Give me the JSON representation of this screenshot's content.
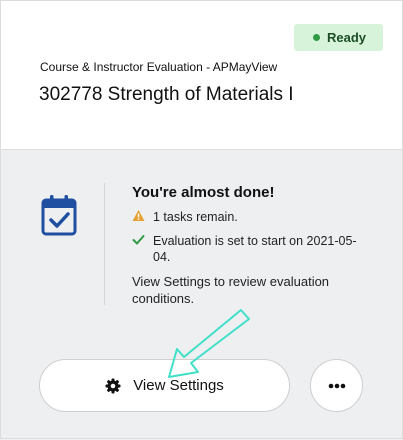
{
  "status": {
    "label": "Ready",
    "color": "#2e9a44",
    "background": "#d7f3da"
  },
  "evaluation": {
    "type": "Course & Instructor Evaluation - APMayView",
    "course_title": "302778 Strength of Materials I"
  },
  "summary": {
    "icon": "calendar-check-icon",
    "title": "You're almost done!",
    "warning": {
      "icon": "warning-icon",
      "text": "1 tasks remain."
    },
    "check": {
      "icon": "check-icon",
      "text": "Evaluation is set to start on 2021-05-04."
    },
    "note": "View Settings to review evaluation conditions."
  },
  "actions": {
    "view_settings": {
      "icon": "gear-icon",
      "label": "View Settings"
    },
    "more": {
      "icon": "more-dots-icon"
    }
  },
  "colors": {
    "accent": "#1f4fa0",
    "warning": "#e5a132",
    "check": "#2e9a44",
    "annotation_arrow": "#3fe0c8"
  }
}
